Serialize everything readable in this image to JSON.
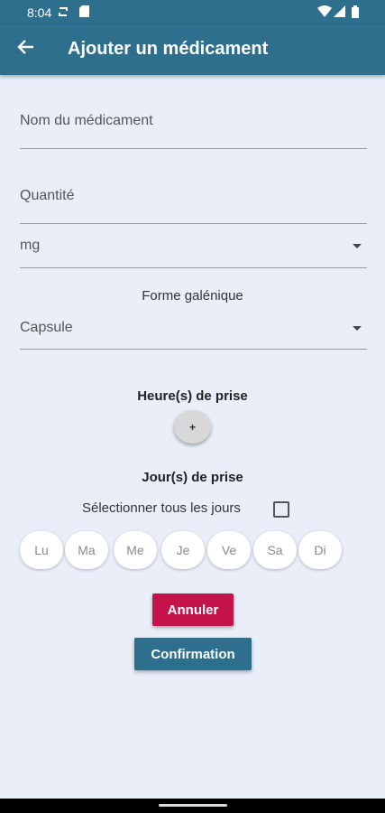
{
  "status_bar": {
    "time": "8:04",
    "icons": [
      "sync-icon",
      "sim-icon",
      "wifi-icon",
      "signal-icon",
      "battery-icon"
    ]
  },
  "appbar": {
    "title": "Ajouter un médicament",
    "back_icon": "arrow-left-icon"
  },
  "form": {
    "name_placeholder": "Nom du médicament",
    "quantity_placeholder": "Quantité",
    "unit_value": "mg",
    "forme_label": "Forme galénique",
    "forme_value": "Capsule",
    "heures_label": "Heure(s) de prise",
    "add_label": "+",
    "jours_label": "Jour(s) de prise",
    "select_all_label": "Sélectionner tous les jours",
    "days": [
      "Lu",
      "Ma",
      "Me",
      "Je",
      "Ve",
      "Sa",
      "Di"
    ],
    "cancel_label": "Annuler",
    "confirm_label": "Confirmation"
  },
  "colors": {
    "primary": "#2e6f8e",
    "cancel": "#c3134a",
    "background": "#e9eef9"
  }
}
